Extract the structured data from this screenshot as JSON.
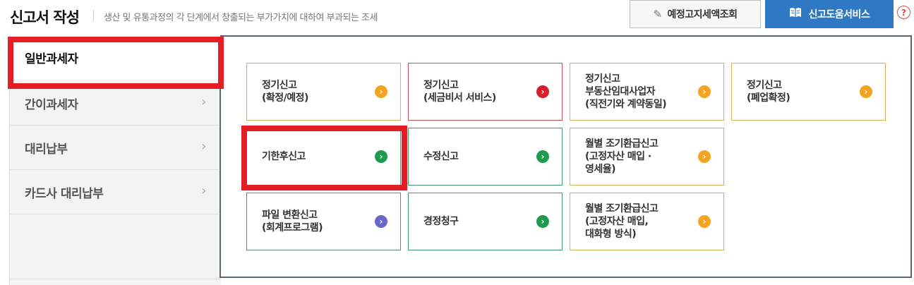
{
  "header": {
    "title": "신고서 작성",
    "subtitle": "생산 및 유통과정의 각 단계에서 창출되는 부가가치에 대하여 부과되는 조세",
    "lookup_button": "예정고지세액조회",
    "help_button": "신고도움서비스",
    "help_icon": "?"
  },
  "sidebar": {
    "items": [
      {
        "label": "일반과세자",
        "active": true
      },
      {
        "label": "간이과세자",
        "chevron": "›"
      },
      {
        "label": "대리납부",
        "chevron": "›"
      },
      {
        "label": "카드사 대리납부",
        "chevron": "›"
      }
    ]
  },
  "cards": [
    {
      "label": "정기신고\n(확정/예정)"
    },
    {
      "label": "정기신고\n(세금비서 서비스)"
    },
    {
      "label": "정기신고\n부동산임대사업자\n(직전기와 계약동일)"
    },
    {
      "label": "정기신고\n(폐업확정)"
    },
    {
      "label": "기한후신고"
    },
    {
      "label": "수정신고"
    },
    {
      "label": "월별 조기환급신고\n(고정자산 매입 ·\n영세율)"
    },
    {
      "label": "파일 변환신고\n(회계프로그램)"
    },
    {
      "label": "경정청구"
    },
    {
      "label": "월별 조기환급신고\n(고정자산 매입,\n대화형 방식)"
    }
  ],
  "arrow_glyph": "›",
  "colors": {
    "primary_blue": "#2f78c4",
    "highlight_red": "#e51e26",
    "arrow_orange": "#f3a521",
    "arrow_red": "#d81f2c",
    "arrow_green": "#1f9b50",
    "arrow_purple": "#6667c8"
  }
}
